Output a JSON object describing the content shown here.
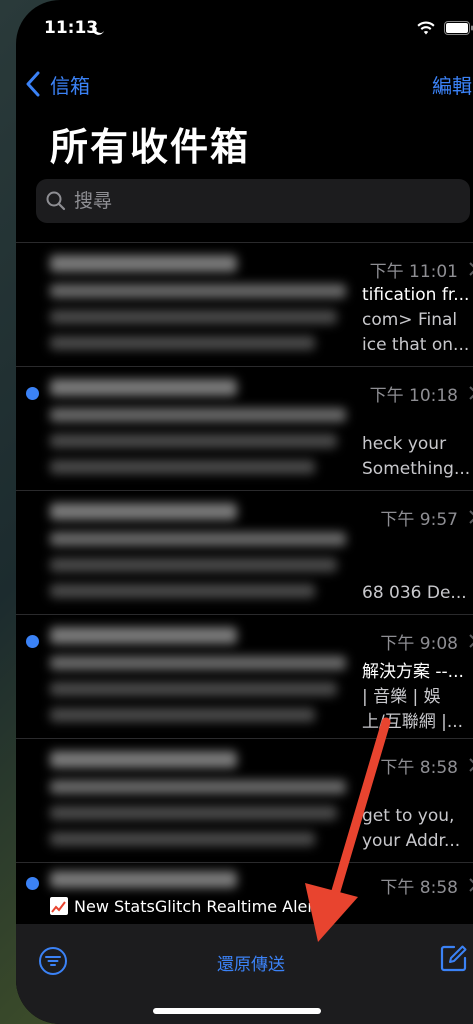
{
  "status": {
    "time": "11:13"
  },
  "nav": {
    "back_label": "信箱",
    "edit_label": "編輯"
  },
  "title": "所有收件箱",
  "search": {
    "placeholder": "搜尋"
  },
  "mails": [
    {
      "time": "下午 11:01",
      "unread": false,
      "s1": "tification fr...",
      "s2": "com> Final",
      "s3": "ice that on..."
    },
    {
      "time": "下午 10:18",
      "unread": true,
      "s1": "",
      "s2": "heck your",
      "s3": "Something..."
    },
    {
      "time": "下午 9:57",
      "unread": false,
      "s1": "",
      "s2": "",
      "s3": "68 036 De..."
    },
    {
      "time": "下午 9:08",
      "unread": true,
      "s1": "解決方案 --...",
      "s2": "| 音樂 | 娛",
      "s3": "上/互聯網 |..."
    },
    {
      "time": "下午 8:58",
      "unread": false,
      "s1": "",
      "s2": "get to you,",
      "s3": "your Addr..."
    }
  ],
  "partial_mail": {
    "time": "下午 8:58",
    "unread": true,
    "subject": "New StatsGlitch Realtime Alert"
  },
  "toolbar": {
    "undo_send_label": "還原傳送"
  },
  "colors": {
    "accent": "#3b82f6",
    "annotation_arrow": "#e8442f"
  }
}
